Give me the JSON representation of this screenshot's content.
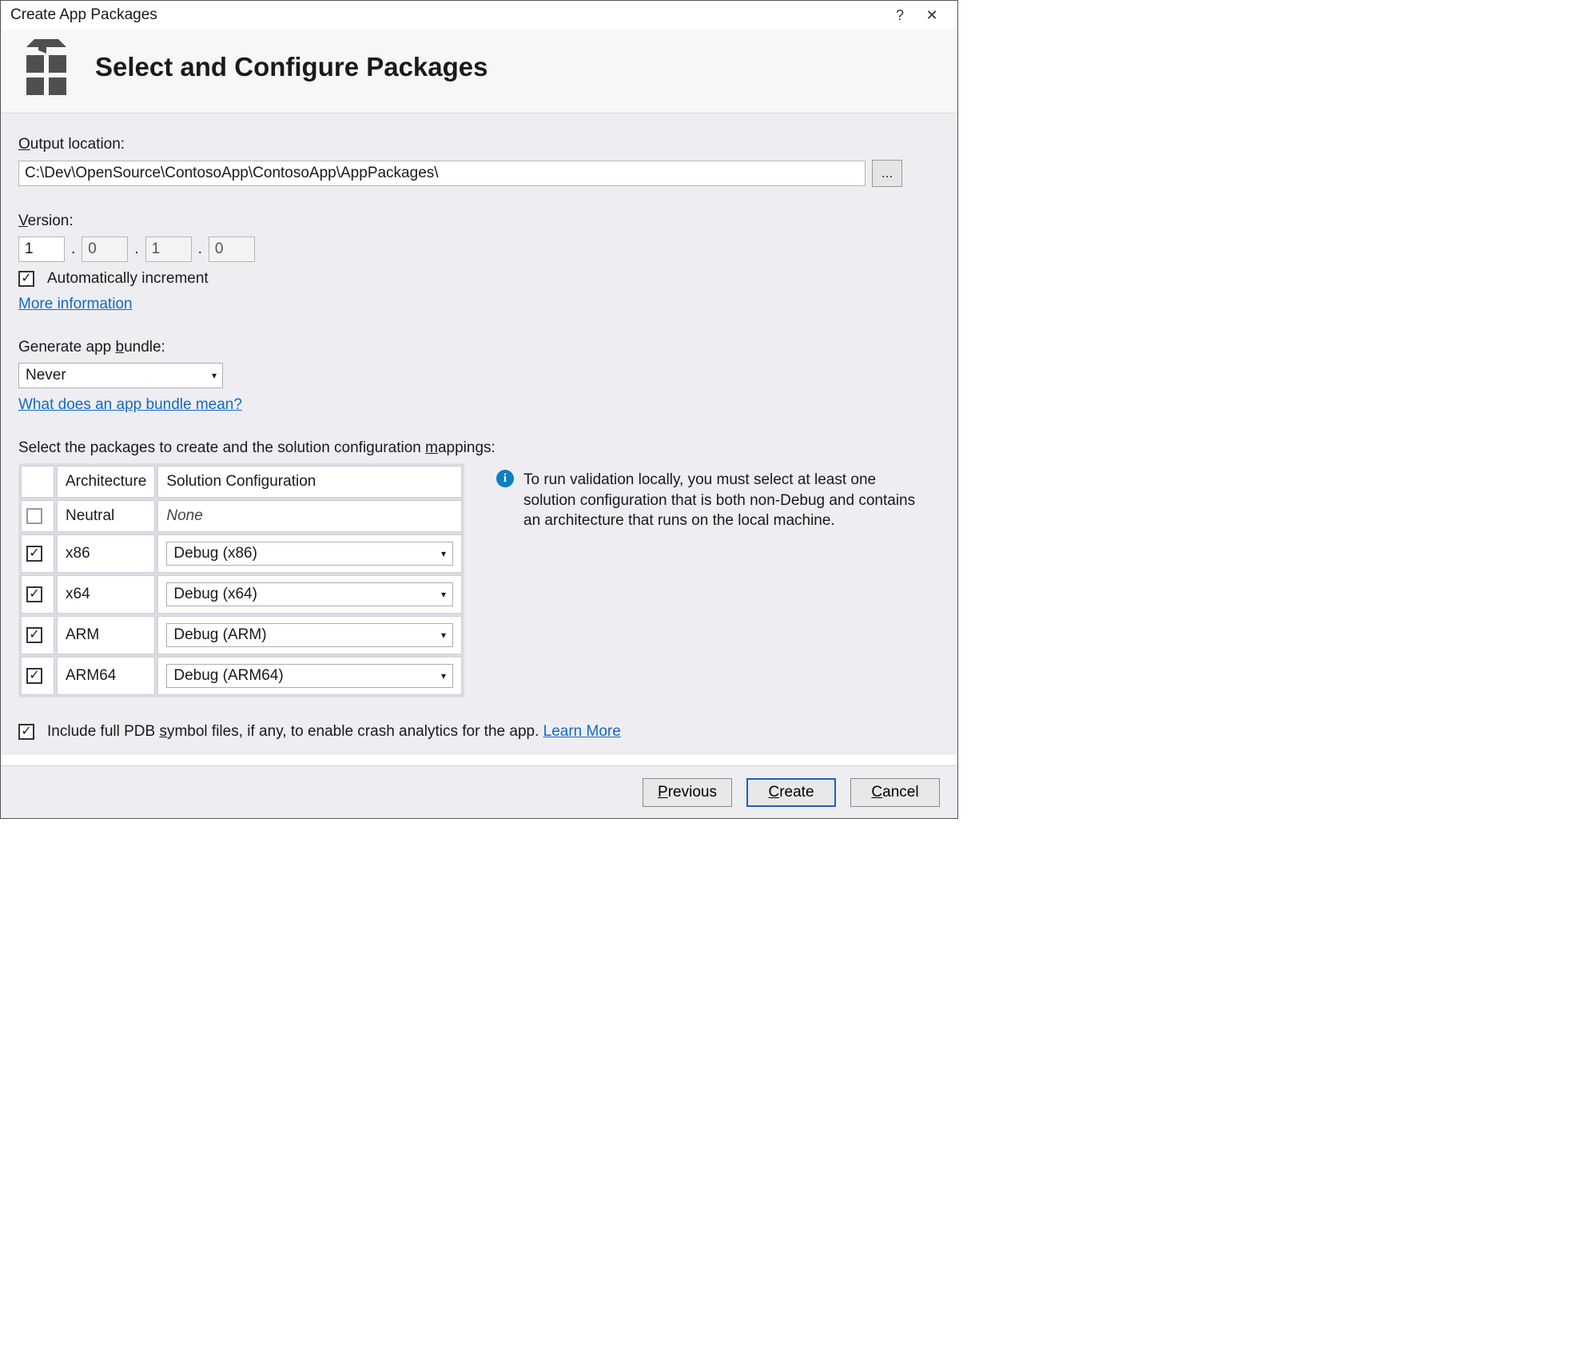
{
  "window": {
    "title": "Create App Packages",
    "help": "?",
    "close": "✕"
  },
  "header": {
    "title": "Select and Configure Packages"
  },
  "output": {
    "label_pre": "O",
    "label_post": "utput location:",
    "path": "C:\\Dev\\OpenSource\\ContosoApp\\ContosoApp\\AppPackages\\",
    "browse": "..."
  },
  "version": {
    "label_pre": "V",
    "label_post": "ersion:",
    "major": "1",
    "minor": "0",
    "build": "1",
    "rev": "0",
    "auto_label": "Automatically increment",
    "more_link": "More information"
  },
  "bundle": {
    "label_pre": "Generate app ",
    "label_u": "b",
    "label_post": "undle:",
    "value": "Never",
    "help_link": "What does an app bundle mean?"
  },
  "mappings": {
    "intro_pre": "Select the packages to create and the solution configuration ",
    "intro_u": "m",
    "intro_post": "appings:",
    "col_arch": "Architecture",
    "col_cfg": "Solution Configuration",
    "rows": [
      {
        "checked": false,
        "arch": "Neutral",
        "cfg": "None",
        "combo": false,
        "disabled_check": true
      },
      {
        "checked": true,
        "arch": "x86",
        "cfg": "Debug (x86)",
        "combo": true
      },
      {
        "checked": true,
        "arch": "x64",
        "cfg": "Debug (x64)",
        "combo": true
      },
      {
        "checked": true,
        "arch": "ARM",
        "cfg": "Debug (ARM)",
        "combo": true
      },
      {
        "checked": true,
        "arch": "ARM64",
        "cfg": "Debug (ARM64)",
        "combo": true
      }
    ],
    "info": "To run validation locally, you must select at least one solution configuration that is both non-Debug and contains an architecture that runs on the local machine."
  },
  "pdb": {
    "label_pre": "Include full PDB ",
    "label_u": "s",
    "label_post": "ymbol files, if any, to enable crash analytics for the app. ",
    "link": "Learn More"
  },
  "footer": {
    "previous_u": "P",
    "previous_rest": "revious",
    "create_u": "C",
    "create_rest": "reate",
    "cancel_u": "C",
    "cancel_rest": "ancel"
  }
}
